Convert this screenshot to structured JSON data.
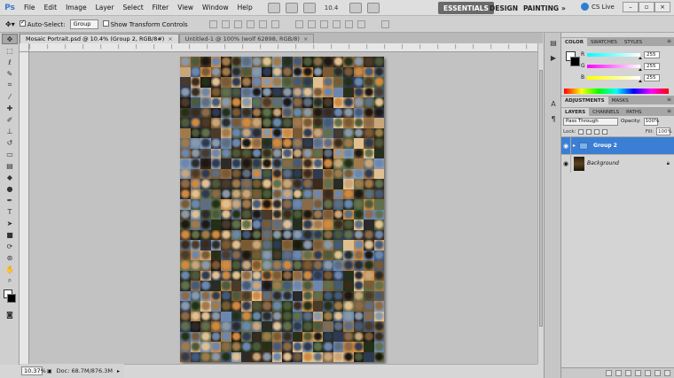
{
  "app": {
    "logo": "Ps"
  },
  "menu": [
    "File",
    "Edit",
    "Image",
    "Layer",
    "Select",
    "Filter",
    "View",
    "Window",
    "Help"
  ],
  "menubar_tools": {
    "zoom": "10.4"
  },
  "workspaces": {
    "essentials": "ESSENTIALS",
    "design": "DESIGN",
    "painting": "PAINTING",
    "more": "»",
    "cslive": "CS Live"
  },
  "options_bar": {
    "auto_select_label": "Auto-Select:",
    "auto_select_checked": true,
    "auto_select_value": "Group",
    "transform_label": "Show Transform Controls",
    "transform_checked": false
  },
  "tools": [
    "move-tool",
    "marquee-tool",
    "lasso-tool",
    "quick-select-tool",
    "crop-tool",
    "eyedropper-tool",
    "healing-tool",
    "brush-tool",
    "stamp-tool",
    "history-brush-tool",
    "eraser-tool",
    "gradient-tool",
    "blur-tool",
    "dodge-tool",
    "pen-tool",
    "type-tool",
    "path-select-tool",
    "shape-tool",
    "3d-rotate-tool",
    "3d-orbit-tool",
    "hand-tool",
    "zoom-tool"
  ],
  "document_tabs": [
    {
      "label": "Mosaic Portrait.psd @ 10.4% (Group 2, RGB/8#)",
      "close": "×",
      "active": true
    },
    {
      "label": "Untitled-1 @ 100% (wolf 62898, RGB/8)",
      "close": "×",
      "active": false
    }
  ],
  "status": {
    "zoom": "10.37%",
    "doc_info": "Doc: 68.7M/876.3M"
  },
  "color_panel": {
    "tabs": [
      "COLOR",
      "SWATCHES",
      "STYLES"
    ],
    "channels": [
      {
        "label": "R",
        "value": "255",
        "color": "#ff00ff"
      },
      {
        "label": "G",
        "value": "255",
        "color": "#00ffff"
      },
      {
        "label": "B",
        "value": "255",
        "color": "#ffff00"
      }
    ]
  },
  "adjustments_panel": {
    "tabs": [
      "ADJUSTMENTS",
      "MASKS"
    ]
  },
  "layers_panel": {
    "tabs": [
      "LAYERS",
      "CHANNELS",
      "PATHS"
    ],
    "blend_mode": "Pass Through",
    "opacity_label": "Opacity:",
    "opacity_value": "100%",
    "lock_label": "Lock:",
    "fill_label": "Fill:",
    "fill_value": "100%",
    "layers": [
      {
        "name": "Group 2",
        "type": "group",
        "selected": true,
        "visible": true
      },
      {
        "name": "Background",
        "type": "image",
        "selected": false,
        "visible": true,
        "locked": true
      }
    ]
  }
}
